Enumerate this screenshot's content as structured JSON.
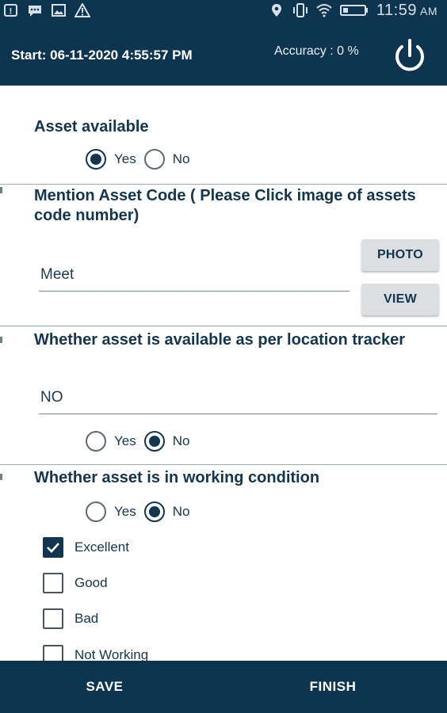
{
  "status_bar": {
    "time": "11:59",
    "ampm": "AM",
    "icons_left": [
      "notification-icon",
      "message-icon",
      "image-icon",
      "warning-icon"
    ],
    "icons_right": [
      "location-icon",
      "vibrate-icon",
      "wifi-icon",
      "battery-icon"
    ]
  },
  "header": {
    "start_label": "Start: 06-11-2020 4:55:57 PM",
    "accuracy_label": "Accuracy : 0 %",
    "power_icon": "power-icon"
  },
  "sections": {
    "asset_available": {
      "title": "Asset available",
      "options": [
        "Yes",
        "No"
      ],
      "selected": "Yes"
    },
    "asset_code": {
      "title": "Mention Asset Code ( Please Click image of assets code number)",
      "value": "Meet",
      "photo_label": "PHOTO",
      "view_label": "VIEW"
    },
    "location_tracker": {
      "title": "Whether asset is available as per location tracker",
      "value": "NO",
      "options": [
        "Yes",
        "No"
      ],
      "selected": "No"
    },
    "working_condition": {
      "title": "Whether asset is in working condition",
      "options": [
        "Yes",
        "No"
      ],
      "selected": "No",
      "conditions": [
        {
          "label": "Excellent",
          "checked": true
        },
        {
          "label": "Good",
          "checked": false
        },
        {
          "label": "Bad",
          "checked": false
        },
        {
          "label": "Not Working",
          "checked": false
        }
      ]
    }
  },
  "footer": {
    "save_label": "SAVE",
    "finish_label": "FINISH"
  },
  "colors": {
    "primary": "#0d3550",
    "text": "#12364f",
    "button_bg": "#dcdfe1"
  }
}
